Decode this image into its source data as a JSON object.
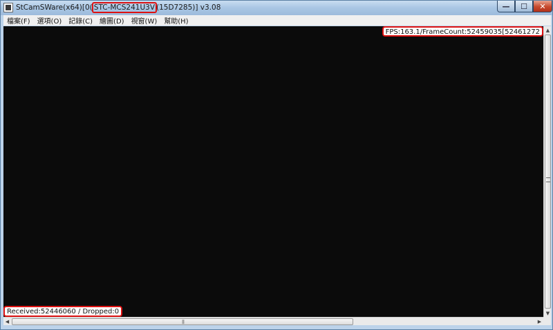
{
  "window": {
    "title_prefix": "StCamSWare(x64)[0(",
    "title_model": "STC-MCS241U3V",
    "title_suffix": "(15D7285)] v3.08",
    "minimize_glyph": "—",
    "maximize_glyph": "☐",
    "close_glyph": "✕"
  },
  "menu": {
    "items": [
      "檔案(F)",
      "選項(O)",
      "記錄(C)",
      "繪圖(D)",
      "視窗(W)",
      "幫助(H)"
    ]
  },
  "overlay": {
    "fps_text": "FPS:163.1/FrameCount:52459035[52461272",
    "received_text": "Received:52446060 / Dropped:0"
  },
  "scrollbars": {
    "up_glyph": "▲",
    "down_glyph": "▼",
    "left_glyph": "◀",
    "right_glyph": "▶"
  },
  "colors": {
    "highlight": "#dd1111",
    "canvas": "#0b0b0b"
  }
}
